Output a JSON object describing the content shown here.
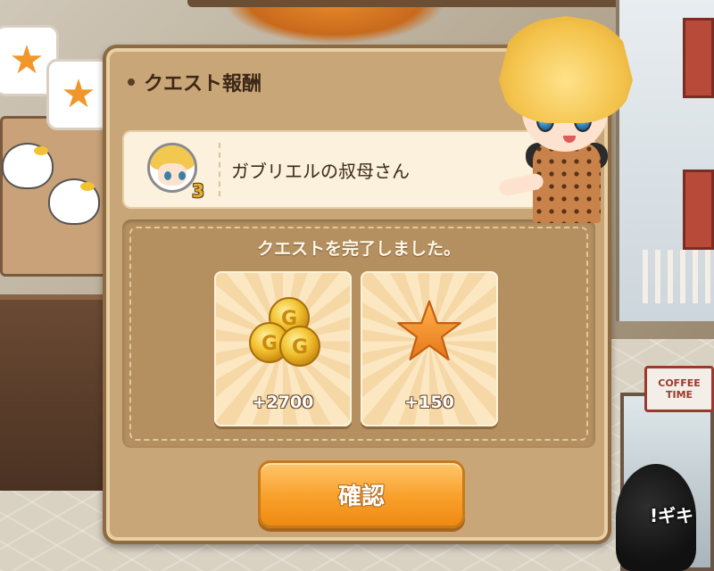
{
  "dialog": {
    "title": "クエスト報酬",
    "npc": {
      "name": "ガブリエルの叔母さん",
      "level": "3"
    },
    "message": "クエストを完了しました。",
    "rewards": [
      {
        "type": "gold",
        "icon": "gold-coins-icon",
        "amount": "+2700",
        "coin_letter": "G"
      },
      {
        "type": "exp",
        "icon": "star-icon",
        "amount": "+150"
      }
    ],
    "confirm_label": "確認"
  },
  "background": {
    "sign_text": "COFFEE TIME",
    "caption": "!ギキ"
  },
  "colors": {
    "dialog_bg": "#c9a677",
    "dialog_border": "#8e6a42",
    "button_orange": "#f8a02a",
    "star": "#f0962a",
    "coin": "#f2c230"
  }
}
